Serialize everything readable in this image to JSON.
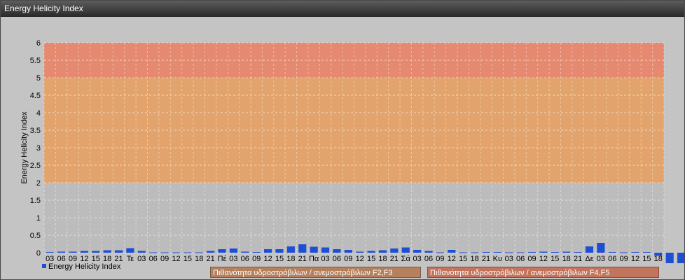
{
  "window": {
    "title": "Energy Helicity Index"
  },
  "colors": {
    "bar": "#1c4fd6",
    "zone_low": "#bcbcbc",
    "zone_f23": "#e2a46c",
    "zone_f45": "#e58a70"
  },
  "legend": {
    "series_label": "Energy Helicity Index",
    "zone_f23_label": "Πιθανότητα υδροστρόβιλων / ανεμοστρόβιλων F2,F3",
    "zone_f45_label": "Πιθανότητα υδροστρόβιλων / ανεμοστρόβιλων F4,F5"
  },
  "chart_data": {
    "type": "bar",
    "title": "",
    "xlabel": "",
    "ylabel": "Energy Helicity Index",
    "ylim": [
      0,
      6
    ],
    "yticks": [
      "0",
      "0.5",
      "1",
      "1.5",
      "2",
      "2.5",
      "3",
      "3.5",
      "4",
      "4.5",
      "5",
      "5.5",
      "6"
    ],
    "grid": true,
    "legend_position": "bottom-left",
    "bands": [
      {
        "from": 0,
        "to": 2,
        "color": "#bcbcbc"
      },
      {
        "from": 2,
        "to": 5,
        "color": "#e2a46c"
      },
      {
        "from": 5,
        "to": 6,
        "color": "#e58a70"
      }
    ],
    "categories": [
      "03",
      "06",
      "09",
      "12",
      "15",
      "18",
      "21",
      "Τε",
      "03",
      "06",
      "09",
      "12",
      "15",
      "18",
      "21",
      "Πέ",
      "03",
      "06",
      "09",
      "12",
      "15",
      "18",
      "21",
      "Πα",
      "03",
      "06",
      "09",
      "12",
      "15",
      "18",
      "21",
      "Σά",
      "03",
      "06",
      "09",
      "12",
      "15",
      "18",
      "21",
      "Κυ",
      "03",
      "06",
      "09",
      "12",
      "15",
      "18",
      "21",
      "Δε",
      "03",
      "06",
      "09",
      "12",
      "15",
      "18"
    ],
    "series": [
      {
        "name": "Energy Helicity Index",
        "values": [
          0.02,
          0.03,
          0.03,
          0.05,
          0.05,
          0.07,
          0.07,
          0.13,
          0.05,
          0.01,
          0.01,
          0.01,
          0.01,
          0.01,
          0.05,
          0.1,
          0.12,
          0.03,
          0.02,
          0.1,
          0.1,
          0.18,
          0.24,
          0.17,
          0.15,
          0.1,
          0.08,
          0.03,
          0.05,
          0.07,
          0.12,
          0.15,
          0.08,
          0.05,
          0.01,
          0.08,
          0.01,
          0.01,
          0.02,
          0.02,
          0.01,
          0.01,
          0.02,
          0.03,
          0.02,
          0.03,
          0.02,
          0.18,
          0.28,
          0.02,
          0.01,
          0.02,
          0.02,
          -0.09,
          -0.3,
          -0.3
        ]
      }
    ]
  }
}
